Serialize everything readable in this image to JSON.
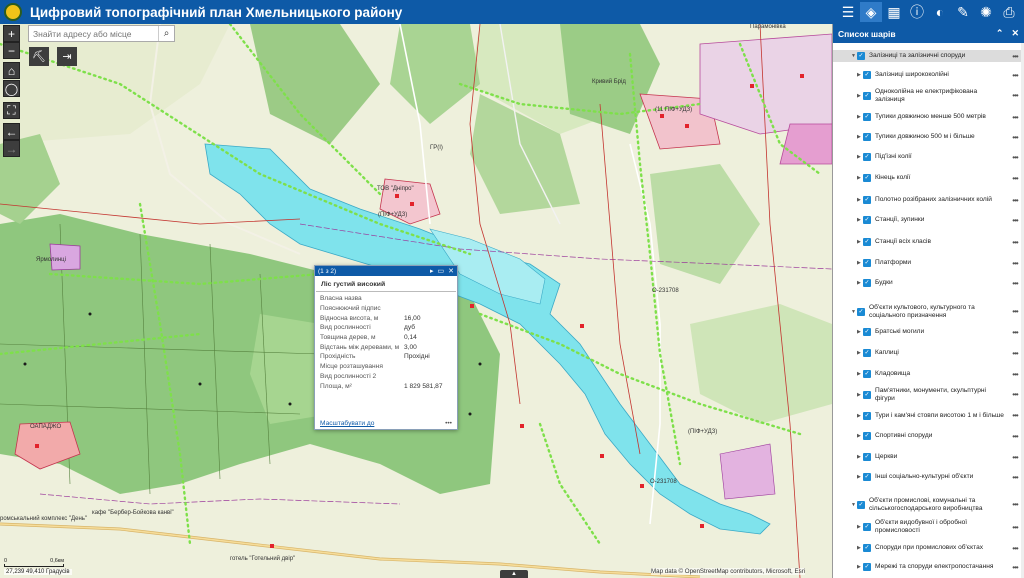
{
  "header": {
    "title": "Цифровий топографічний план Хмельницького району",
    "tools": [
      {
        "icon": "list-icon",
        "glyph": "☰"
      },
      {
        "icon": "layers-icon",
        "glyph": "◈"
      },
      {
        "icon": "basemap-icon",
        "glyph": "▦"
      },
      {
        "icon": "info-icon",
        "glyph": "ⓘ"
      },
      {
        "icon": "swipe-icon",
        "glyph": "◐"
      },
      {
        "icon": "measure-icon",
        "glyph": "✎"
      },
      {
        "icon": "satellite-icon",
        "glyph": "✺"
      },
      {
        "icon": "print-icon",
        "glyph": "⎙"
      }
    ]
  },
  "search": {
    "placeholder": "Знайти адресу або місце",
    "icon": "search-icon"
  },
  "map_controls": {
    "zoom_in": "+",
    "zoom_out": "−"
  },
  "map_labels": [
    {
      "text": "ГР(І)"
    },
    {
      "text": "ТОВ \"Дніпро\""
    },
    {
      "text": "(ПІФ+УДЗ)"
    },
    {
      "text": "Ярмолинці"
    },
    {
      "text": "(ПІФ+УДЗ)"
    },
    {
      "text": "О-231708"
    },
    {
      "text": "Кривий Брід"
    },
    {
      "text": "Парамонівка"
    },
    {
      "text": "(11 ПІФ+УДЗ)"
    },
    {
      "text": "ОАПАДЖО"
    },
    {
      "text": "О-231708"
    },
    {
      "text": "ромськальний комплекс \"День\""
    },
    {
      "text": "кафе \"Бербер-Бойкова канві\""
    },
    {
      "text": "готель \"Готельний двір\""
    }
  ],
  "popup": {
    "counter": "(1 з 2)",
    "title": "Ліс густий високий",
    "attributes": [
      {
        "key": "Власна назва",
        "value": ""
      },
      {
        "key": "Пояснюючий підпис",
        "value": ""
      },
      {
        "key": "Відносна висота, м",
        "value": "16,00"
      },
      {
        "key": "Вид рослинності",
        "value": "дуб"
      },
      {
        "key": "Товщина дерев, м",
        "value": "0,14"
      },
      {
        "key": "Відстань між деревами, м",
        "value": "3,00"
      },
      {
        "key": "Прохідність",
        "value": "Прохідні"
      },
      {
        "key": "Місце розташування",
        "value": ""
      },
      {
        "key": "Вид рослинності 2",
        "value": ""
      },
      {
        "key": "Площа, м²",
        "value": "1 829 581,87"
      }
    ],
    "zoom_link": "Масштабувати до",
    "more": "•••"
  },
  "panel": {
    "title": "Список шарів",
    "layers": [
      {
        "label": "Залізниці та залізничні споруди",
        "level": 0,
        "selected": true
      },
      {
        "label": "Залізниці ширококолійні",
        "level": 1
      },
      {
        "label": "Одноколійна не електрифікована залізниця",
        "level": 1
      },
      {
        "label": "Тупики довжиною менше 500 метрів",
        "level": 1
      },
      {
        "label": "Тупики довжиною 500 м і більше",
        "level": 1
      },
      {
        "label": "Під'їзні колії",
        "level": 1
      },
      {
        "label": "Кінець колії",
        "level": 1
      },
      {
        "label": "Полотно розібраних залізничних колій",
        "level": 1
      },
      {
        "label": "Станції, зупинки",
        "level": 1
      },
      {
        "label": "Станції всіх класів",
        "level": 1
      },
      {
        "label": "Платформи",
        "level": 1
      },
      {
        "label": "Будки",
        "level": 1
      },
      {
        "label": "Об'єкти культового, культурного та соціального призначення",
        "level": 0
      },
      {
        "label": "Братські могили",
        "level": 1
      },
      {
        "label": "Каплиці",
        "level": 1
      },
      {
        "label": "Кладовища",
        "level": 1
      },
      {
        "label": "Пам'ятники, монументи, скульптурні фігури",
        "level": 1
      },
      {
        "label": "Тури і кам'яні стовпи висотою 1 м і більше",
        "level": 1
      },
      {
        "label": "Спортивні споруди",
        "level": 1
      },
      {
        "label": "Церкви",
        "level": 1
      },
      {
        "label": "Інші соціально-культурні об'єкти",
        "level": 1
      },
      {
        "label": "Об'єкти промислові, комунальні та сільськогосподарського виробництва",
        "level": 0
      },
      {
        "label": "Об'єкти видобувної і обробної промисловості",
        "level": 1
      },
      {
        "label": "Споруди при промислових об'єктах",
        "level": 1
      },
      {
        "label": "Мережі та споруди електропостачання",
        "level": 1
      }
    ]
  },
  "status": {
    "scale_left": "0",
    "scale_right": "0,6км",
    "coords": "27,239 49,410 Градусів",
    "attribution": "Map data © OpenStreetMap contributors, Microsoft, Esri"
  },
  "colors": {
    "header": "#0e5aa7",
    "water": "#7fe3ec",
    "forest": "#8fc77e"
  }
}
